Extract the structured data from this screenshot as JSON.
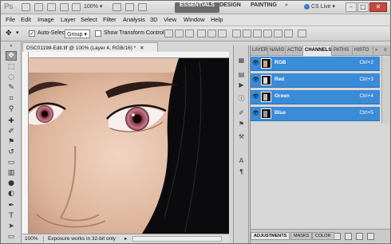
{
  "titlebar": {
    "app_logo": "Ps",
    "zoom": "100%",
    "workspaces": [
      "ESSENTIALS",
      "DESIGN",
      "PAINTING"
    ],
    "active_workspace": "ESSENTIALS",
    "more": "»",
    "cs_live": "CS Live"
  },
  "menus": [
    "File",
    "Edit",
    "Image",
    "Layer",
    "Select",
    "Filter",
    "Analysis",
    "3D",
    "View",
    "Window",
    "Help"
  ],
  "options": {
    "auto_select_label": "Auto-Select:",
    "auto_select_value": "Group",
    "show_transform_label": "Show Transform Controls"
  },
  "document": {
    "tab_title": "DSC01198-Edit.tif @ 100% (Layer 4, RGB/16) *",
    "zoom_status": "100%",
    "status_text": "Exposure works in 32-bit only"
  },
  "panel": {
    "tabs": [
      "LAYER",
      "NAVIG",
      "ACTIO",
      "CHANNELS",
      "PATHS",
      "HISTO"
    ],
    "active_tab": "CHANNELS",
    "channels": [
      {
        "name": "RGB",
        "shortcut": "Ctrl+2"
      },
      {
        "name": "Red",
        "shortcut": "Ctrl+3"
      },
      {
        "name": "Green",
        "shortcut": "Ctrl+4"
      },
      {
        "name": "Blue",
        "shortcut": "Ctrl+5"
      }
    ],
    "bottom_tabs": [
      "ADJUSTMENTS",
      "MASKS",
      "COLOR"
    ],
    "active_bottom_tab": "ADJUSTMENTS"
  },
  "colors": {
    "channel_highlight": "#3a8bd8",
    "workspace_active": "#6a6a6a",
    "close_button": "#c9463d"
  }
}
